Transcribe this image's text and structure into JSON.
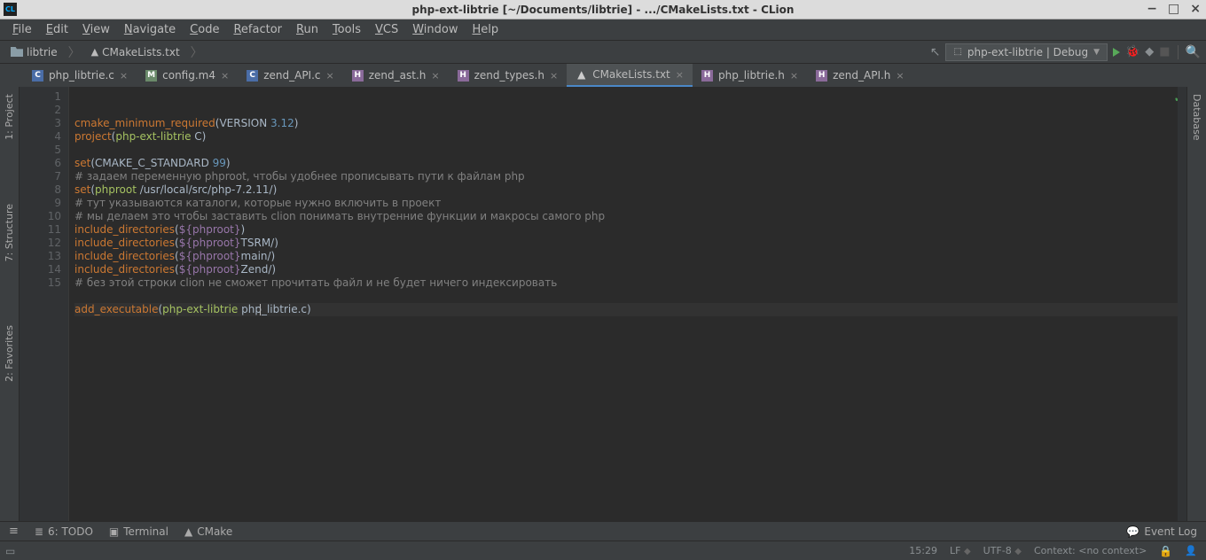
{
  "title": "php-ext-libtrie [~/Documents/libtrie] - .../CMakeLists.txt - CLion",
  "logo": "CL",
  "menu": [
    "File",
    "Edit",
    "View",
    "Navigate",
    "Code",
    "Refactor",
    "Run",
    "Tools",
    "VCS",
    "Window",
    "Help"
  ],
  "breadcrumb": [
    {
      "label": "libtrie",
      "icon": "folder"
    },
    {
      "label": "CMakeLists.txt",
      "icon": "cmake"
    }
  ],
  "run_config": {
    "label": "php-ext-libtrie | Debug"
  },
  "tabs": [
    {
      "label": "php_libtrie.c",
      "type": "c",
      "active": false
    },
    {
      "label": "config.m4",
      "type": "m4",
      "active": false
    },
    {
      "label": "zend_API.c",
      "type": "c",
      "active": false
    },
    {
      "label": "zend_ast.h",
      "type": "h",
      "active": false
    },
    {
      "label": "zend_types.h",
      "type": "h",
      "active": false
    },
    {
      "label": "CMakeLists.txt",
      "type": "cmake",
      "active": true
    },
    {
      "label": "php_libtrie.h",
      "type": "h",
      "active": false
    },
    {
      "label": "zend_API.h",
      "type": "h",
      "active": false
    }
  ],
  "left_tools": [
    {
      "name": "project",
      "label": "1: Project"
    },
    {
      "name": "structure",
      "label": "7: Structure"
    },
    {
      "name": "favorites",
      "label": "2: Favorites"
    }
  ],
  "right_tools": [
    {
      "name": "database",
      "label": "Database"
    }
  ],
  "code_lines": [
    {
      "n": 1,
      "tokens": [
        {
          "t": "kw",
          "s": "cmake_minimum_required"
        },
        {
          "t": "",
          "s": "("
        },
        {
          "t": "",
          "s": "VERSION "
        },
        {
          "t": "num",
          "s": "3.12"
        },
        {
          "t": "",
          "s": ")"
        }
      ]
    },
    {
      "n": 2,
      "tokens": [
        {
          "t": "kw",
          "s": "project"
        },
        {
          "t": "",
          "s": "("
        },
        {
          "t": "ident",
          "s": "php-ext-libtrie"
        },
        {
          "t": "",
          "s": " C)"
        }
      ]
    },
    {
      "n": 3,
      "tokens": []
    },
    {
      "n": 4,
      "tokens": [
        {
          "t": "kw",
          "s": "set"
        },
        {
          "t": "",
          "s": "(CMAKE_C_STANDARD "
        },
        {
          "t": "num",
          "s": "99"
        },
        {
          "t": "",
          "s": ")"
        }
      ]
    },
    {
      "n": 5,
      "tokens": [
        {
          "t": "cmt",
          "s": "# задаем переменную phproot, чтобы удобнее прописывать пути к файлам php"
        }
      ]
    },
    {
      "n": 6,
      "tokens": [
        {
          "t": "kw",
          "s": "set"
        },
        {
          "t": "",
          "s": "("
        },
        {
          "t": "ident",
          "s": "phproot"
        },
        {
          "t": "",
          "s": " /usr/local/src/php-7.2.11/)"
        }
      ]
    },
    {
      "n": 7,
      "tokens": [
        {
          "t": "cmt",
          "s": "# тут указываются каталоги, которые нужно включить в проект"
        }
      ]
    },
    {
      "n": 8,
      "tokens": [
        {
          "t": "cmt",
          "s": "# мы делаем это чтобы заставить clion понимать внутренние функции и макросы самого php"
        }
      ]
    },
    {
      "n": 9,
      "tokens": [
        {
          "t": "kw",
          "s": "include_directories"
        },
        {
          "t": "",
          "s": "("
        },
        {
          "t": "var",
          "s": "${phproot}"
        },
        {
          "t": "",
          "s": ")"
        }
      ]
    },
    {
      "n": 10,
      "tokens": [
        {
          "t": "kw",
          "s": "include_directories"
        },
        {
          "t": "",
          "s": "("
        },
        {
          "t": "var",
          "s": "${phproot}"
        },
        {
          "t": "",
          "s": "TSRM/)"
        }
      ]
    },
    {
      "n": 11,
      "tokens": [
        {
          "t": "kw",
          "s": "include_directories"
        },
        {
          "t": "",
          "s": "("
        },
        {
          "t": "var",
          "s": "${phproot}"
        },
        {
          "t": "",
          "s": "main/)"
        }
      ]
    },
    {
      "n": 12,
      "tokens": [
        {
          "t": "kw",
          "s": "include_directories"
        },
        {
          "t": "",
          "s": "("
        },
        {
          "t": "var",
          "s": "${phproot}"
        },
        {
          "t": "",
          "s": "Zend/)"
        }
      ]
    },
    {
      "n": 13,
      "tokens": [
        {
          "t": "cmt",
          "s": "# без этой строки clion не сможет прочитать файл и не будет ничего индексировать"
        }
      ]
    },
    {
      "n": 14,
      "tokens": []
    },
    {
      "n": 15,
      "tokens": [
        {
          "t": "kw",
          "s": "add_executable"
        },
        {
          "t": "",
          "s": "("
        },
        {
          "t": "ident",
          "s": "php-ext-libtrie"
        },
        {
          "t": "",
          "s": " "
        },
        {
          "t": "",
          "s": "php_libtrie.c"
        },
        {
          "t": "",
          "s": ")"
        }
      ],
      "cursor": 29
    }
  ],
  "bottom_tools": [
    {
      "name": "todo",
      "label": "6: TODO",
      "icon": "≣"
    },
    {
      "name": "terminal",
      "label": "Terminal",
      "icon": "▣"
    },
    {
      "name": "cmake",
      "label": "CMake",
      "icon": "▲"
    }
  ],
  "event_log": "Event Log",
  "status": {
    "pos": "15:29",
    "lf": "LF",
    "enc": "UTF-8",
    "ctx": "Context: <no context>"
  }
}
